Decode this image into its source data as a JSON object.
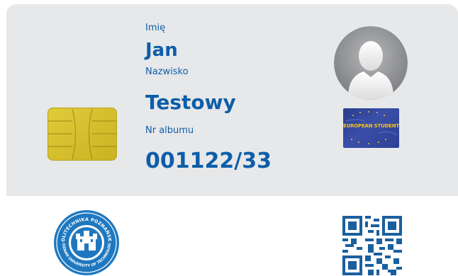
{
  "card": {
    "first_name_label": "Imię",
    "first_name": "Jan",
    "last_name_label": "Nazwisko",
    "last_name": "Testowy",
    "album_label": "Nr  albumu",
    "album_number": "001122/33"
  },
  "badge": {
    "text": "EUROPEAN STUDENT"
  },
  "seal": {
    "text_top": "POLITECHNIKA POZNAŃSKA",
    "text_bottom": "POZNAN UNIVERSITY OF TECHNOLOGY"
  },
  "icons": {
    "chip": "smart-card-chip-icon",
    "avatar": "user-avatar-icon",
    "badge": "european-student-card-logo",
    "seal": "university-seal-logo",
    "qr": "qr-code-icon"
  },
  "colors": {
    "text_blue": "#0d5ea8",
    "card_grey": "#e7e8ea",
    "chip_gold": "#d6c02c",
    "seal_blue": "#1f78bf"
  }
}
